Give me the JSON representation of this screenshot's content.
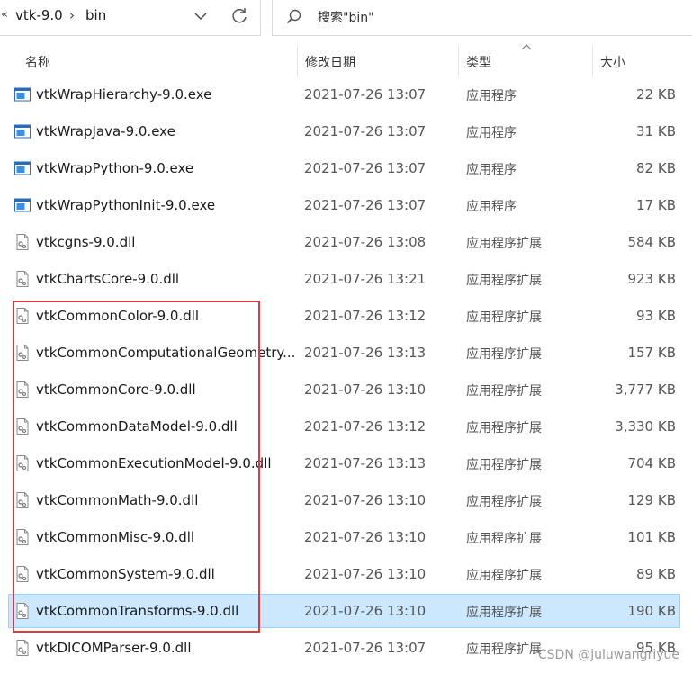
{
  "address_bar": {
    "overflow_glyph": "«",
    "crumbs": [
      "vtk-9.0",
      "bin"
    ],
    "separator": "›"
  },
  "search": {
    "placeholder": "搜索\"bin\""
  },
  "columns": {
    "name": "名称",
    "date": "修改日期",
    "type": "类型",
    "size": "大小"
  },
  "files": [
    {
      "name": "vtkWrapHierarchy-9.0.exe",
      "date": "2021-07-26 13:07",
      "type": "应用程序",
      "size": "22 KB",
      "icon": "exe-icon"
    },
    {
      "name": "vtkWrapJava-9.0.exe",
      "date": "2021-07-26 13:07",
      "type": "应用程序",
      "size": "31 KB",
      "icon": "exe-icon"
    },
    {
      "name": "vtkWrapPython-9.0.exe",
      "date": "2021-07-26 13:07",
      "type": "应用程序",
      "size": "82 KB",
      "icon": "exe-icon"
    },
    {
      "name": "vtkWrapPythonInit-9.0.exe",
      "date": "2021-07-26 13:07",
      "type": "应用程序",
      "size": "17 KB",
      "icon": "exe-icon"
    },
    {
      "name": "vtkcgns-9.0.dll",
      "date": "2021-07-26 13:08",
      "type": "应用程序扩展",
      "size": "584 KB",
      "icon": "dll-icon"
    },
    {
      "name": "vtkChartsCore-9.0.dll",
      "date": "2021-07-26 13:21",
      "type": "应用程序扩展",
      "size": "923 KB",
      "icon": "dll-icon"
    },
    {
      "name": "vtkCommonColor-9.0.dll",
      "date": "2021-07-26 13:12",
      "type": "应用程序扩展",
      "size": "93 KB",
      "icon": "dll-icon"
    },
    {
      "name": "vtkCommonComputationalGeometry...",
      "date": "2021-07-26 13:13",
      "type": "应用程序扩展",
      "size": "157 KB",
      "icon": "dll-icon"
    },
    {
      "name": "vtkCommonCore-9.0.dll",
      "date": "2021-07-26 13:10",
      "type": "应用程序扩展",
      "size": "3,777 KB",
      "icon": "dll-icon"
    },
    {
      "name": "vtkCommonDataModel-9.0.dll",
      "date": "2021-07-26 13:12",
      "type": "应用程序扩展",
      "size": "3,330 KB",
      "icon": "dll-icon"
    },
    {
      "name": "vtkCommonExecutionModel-9.0.dll",
      "date": "2021-07-26 13:13",
      "type": "应用程序扩展",
      "size": "704 KB",
      "icon": "dll-icon"
    },
    {
      "name": "vtkCommonMath-9.0.dll",
      "date": "2021-07-26 13:10",
      "type": "应用程序扩展",
      "size": "129 KB",
      "icon": "dll-icon"
    },
    {
      "name": "vtkCommonMisc-9.0.dll",
      "date": "2021-07-26 13:10",
      "type": "应用程序扩展",
      "size": "101 KB",
      "icon": "dll-icon"
    },
    {
      "name": "vtkCommonSystem-9.0.dll",
      "date": "2021-07-26 13:10",
      "type": "应用程序扩展",
      "size": "89 KB",
      "icon": "dll-icon"
    },
    {
      "name": "vtkCommonTransforms-9.0.dll",
      "date": "2021-07-26 13:10",
      "type": "应用程序扩展",
      "size": "190 KB",
      "icon": "dll-icon",
      "selected": true
    },
    {
      "name": "vtkDICOMParser-9.0.dll",
      "date": "2021-07-26 13:07",
      "type": "应用程序扩展",
      "size": "95 KB",
      "icon": "dll-icon"
    }
  ],
  "annotation_color": "#e0383e",
  "selection_color": "#cce8ff",
  "watermark": "CSDN @juluwangriyue"
}
